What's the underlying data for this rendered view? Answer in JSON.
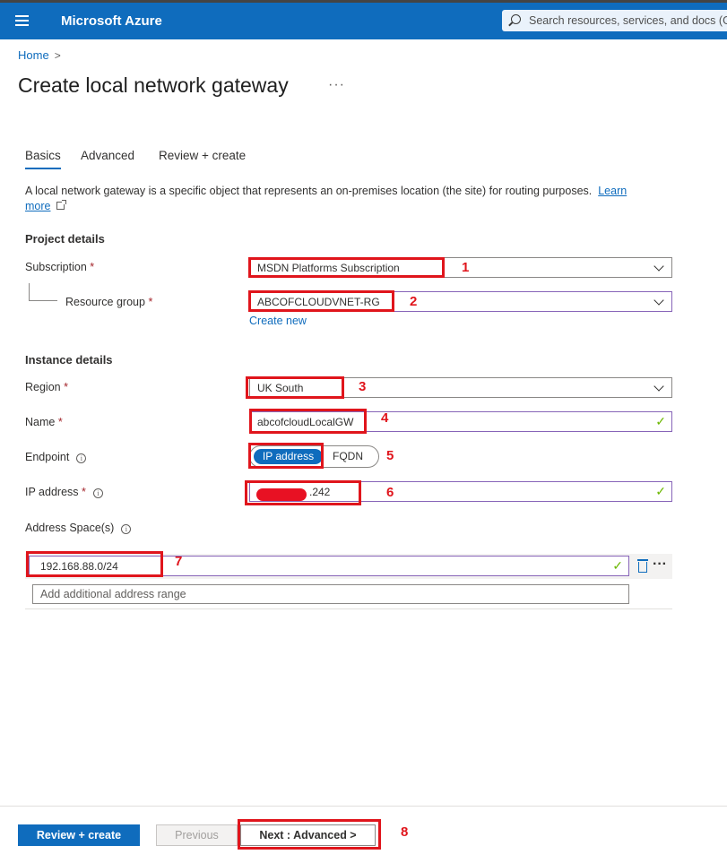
{
  "header": {
    "brand": "Microsoft Azure",
    "search_placeholder": "Search resources, services, and docs (G"
  },
  "breadcrumb": {
    "home": "Home",
    "separator": ">"
  },
  "page": {
    "title": "Create local network gateway",
    "more": "···"
  },
  "tabs": [
    {
      "label": "Basics",
      "active": true
    },
    {
      "label": "Advanced",
      "active": false
    },
    {
      "label": "Review + create",
      "active": false
    }
  ],
  "description": {
    "text": "A local network gateway is a specific object that represents an on-premises location (the site) for routing purposes.",
    "link_text": "Learn more",
    "link_part1": "Learn",
    "link_part2": "more"
  },
  "project_details": {
    "heading": "Project details",
    "subscription_label": "Subscription",
    "subscription_value": "MSDN Platforms Subscription",
    "resource_group_label": "Resource group",
    "resource_group_value": "ABCOFCLOUDVNET-RG",
    "create_new": "Create new"
  },
  "instance_details": {
    "heading": "Instance details",
    "region_label": "Region",
    "region_value": "UK South",
    "name_label": "Name",
    "name_value": "abcofcloudLocalGW",
    "endpoint_label": "Endpoint",
    "endpoint_options": [
      "IP address",
      "FQDN"
    ],
    "endpoint_selected": "IP address",
    "ip_label": "IP address",
    "ip_value_visible": ".242",
    "address_space_label": "Address Space(s)",
    "address_space_value": "192.168.88.0/24",
    "address_add_placeholder": "Add additional address range"
  },
  "required_marker": "*",
  "info_glyph": "i",
  "check_glyph": "✓",
  "footer": {
    "review_create": "Review + create",
    "previous": "Previous",
    "next": "Next : Advanced >"
  },
  "annotations": [
    "1",
    "2",
    "3",
    "4",
    "5",
    "6",
    "7",
    "8"
  ],
  "colors": {
    "accent": "#0f6cbd",
    "annotation": "#e0151c",
    "valid_check": "#6bb700"
  }
}
